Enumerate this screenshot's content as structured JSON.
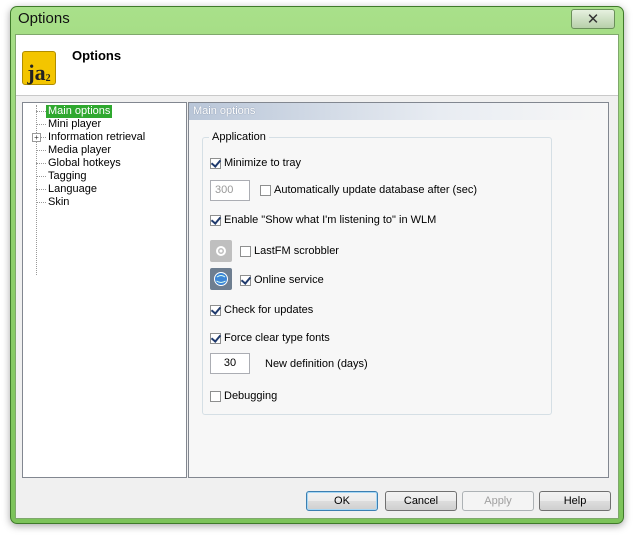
{
  "window": {
    "title": "Options",
    "close_glyph": "✕"
  },
  "header": {
    "logo_text": "ja",
    "logo_sup": "2",
    "title": "Options"
  },
  "tree": {
    "items": [
      {
        "label": "Main options",
        "selected": true
      },
      {
        "label": "Mini player"
      },
      {
        "label": "Information retrieval",
        "expandable": true
      },
      {
        "label": "Media player"
      },
      {
        "label": "Global hotkeys"
      },
      {
        "label": "Tagging"
      },
      {
        "label": "Language"
      },
      {
        "label": "Skin"
      }
    ],
    "expander_glyph": "+"
  },
  "panel": {
    "heading": "Main options",
    "group_label": "Application",
    "minimize_to_tray": {
      "label": "Minimize to tray",
      "checked": true
    },
    "update_interval": {
      "value": "300"
    },
    "auto_update": {
      "label": "Automatically update database after (sec)",
      "checked": false
    },
    "show_listening": {
      "label": "Enable \"Show what I'm listening to\" in WLM",
      "checked": true
    },
    "lastfm": {
      "label": "LastFM scrobbler",
      "checked": false
    },
    "online_service": {
      "label": "Online service",
      "checked": true
    },
    "check_updates": {
      "label": "Check for updates",
      "checked": true
    },
    "clear_type": {
      "label": "Force clear type fonts",
      "checked": true
    },
    "new_definition": {
      "value": "30",
      "label": "New definition (days)"
    },
    "debugging": {
      "label": "Debugging",
      "checked": false
    }
  },
  "buttons": {
    "ok": "OK",
    "cancel": "Cancel",
    "apply": "Apply",
    "help": "Help"
  },
  "colors": {
    "selection": "#2fa82f",
    "frame": "#8fd06c",
    "logo": "#f3c500"
  }
}
